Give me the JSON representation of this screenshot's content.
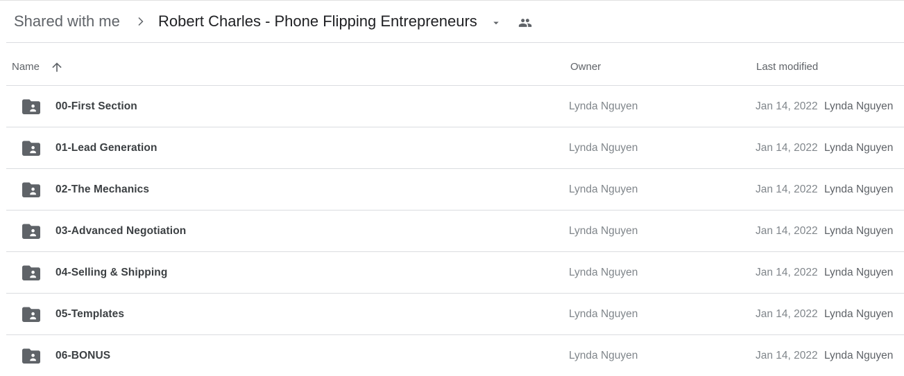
{
  "breadcrumb": {
    "root_label": "Shared with me",
    "separator_icon": "chevron-right-icon",
    "current_folder": "Robert Charles - Phone Flipping Entrepreneurs",
    "dropdown_icon": "arrow-drop-down-icon",
    "shared_icon": "people-icon"
  },
  "columns": {
    "name": "Name",
    "sort_icon": "arrow-up-icon",
    "sort_direction": "ascending",
    "owner": "Owner",
    "last_modified": "Last modified"
  },
  "files": [
    {
      "name": "00-First Section",
      "type": "shared-folder",
      "owner": "Lynda Nguyen",
      "modified_date": "Jan 14, 2022",
      "modified_by": "Lynda Nguyen"
    },
    {
      "name": "01-Lead Generation",
      "type": "shared-folder",
      "owner": "Lynda Nguyen",
      "modified_date": "Jan 14, 2022",
      "modified_by": "Lynda Nguyen"
    },
    {
      "name": "02-The Mechanics",
      "type": "shared-folder",
      "owner": "Lynda Nguyen",
      "modified_date": "Jan 14, 2022",
      "modified_by": "Lynda Nguyen"
    },
    {
      "name": "03-Advanced Negotiation",
      "type": "shared-folder",
      "owner": "Lynda Nguyen",
      "modified_date": "Jan 14, 2022",
      "modified_by": "Lynda Nguyen"
    },
    {
      "name": "04-Selling & Shipping",
      "type": "shared-folder",
      "owner": "Lynda Nguyen",
      "modified_date": "Jan 14, 2022",
      "modified_by": "Lynda Nguyen"
    },
    {
      "name": "05-Templates",
      "type": "shared-folder",
      "owner": "Lynda Nguyen",
      "modified_date": "Jan 14, 2022",
      "modified_by": "Lynda Nguyen"
    },
    {
      "name": "06-BONUS",
      "type": "shared-folder",
      "owner": "Lynda Nguyen",
      "modified_date": "Jan 14, 2022",
      "modified_by": "Lynda Nguyen"
    }
  ],
  "colors": {
    "folder_icon": "#5f6368",
    "divider": "#dadce0",
    "primary_text": "#3c4043",
    "secondary_text": "#80868b"
  }
}
